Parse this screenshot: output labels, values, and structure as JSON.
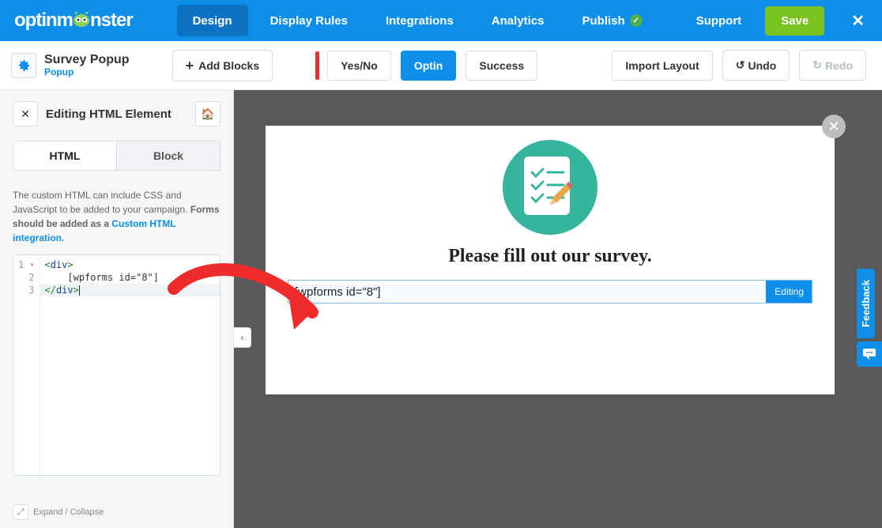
{
  "brand": "optinm  nster",
  "nav": {
    "design": "Design",
    "display_rules": "Display Rules",
    "integrations": "Integrations",
    "analytics": "Analytics",
    "publish": "Publish",
    "support": "Support",
    "save": "Save"
  },
  "campaign": {
    "title": "Survey Popup",
    "type": "Popup"
  },
  "toolbar": {
    "add_blocks": "Add Blocks",
    "yesno": "Yes/No",
    "optin": "Optin",
    "success": "Success",
    "import_layout": "Import Layout",
    "undo": "Undo",
    "redo": "Redo"
  },
  "panel": {
    "title": "Editing HTML Element",
    "tabs": {
      "html": "HTML",
      "block": "Block"
    },
    "help_1": "The custom HTML can include CSS and JavaScript to be added to your campaign. ",
    "help_bold": "Forms should be added as a ",
    "help_link": "Custom HTML integration.",
    "code": {
      "l1_open": "<",
      "l1_tag": "div",
      "l1_close": ">",
      "l2": "    [wpforms id=\"8\"]",
      "l3_open": "</",
      "l3_tag": "div",
      "l3_close": ">"
    },
    "lines": {
      "n1": "1",
      "n2": "2",
      "n3": "3"
    },
    "expand": "Expand / Collapse"
  },
  "popup": {
    "headline": "Please fill out our survey.",
    "html_block": "[wpforms id=\"8\"]",
    "editing": "Editing"
  },
  "feedback": {
    "label": "Feedback"
  }
}
